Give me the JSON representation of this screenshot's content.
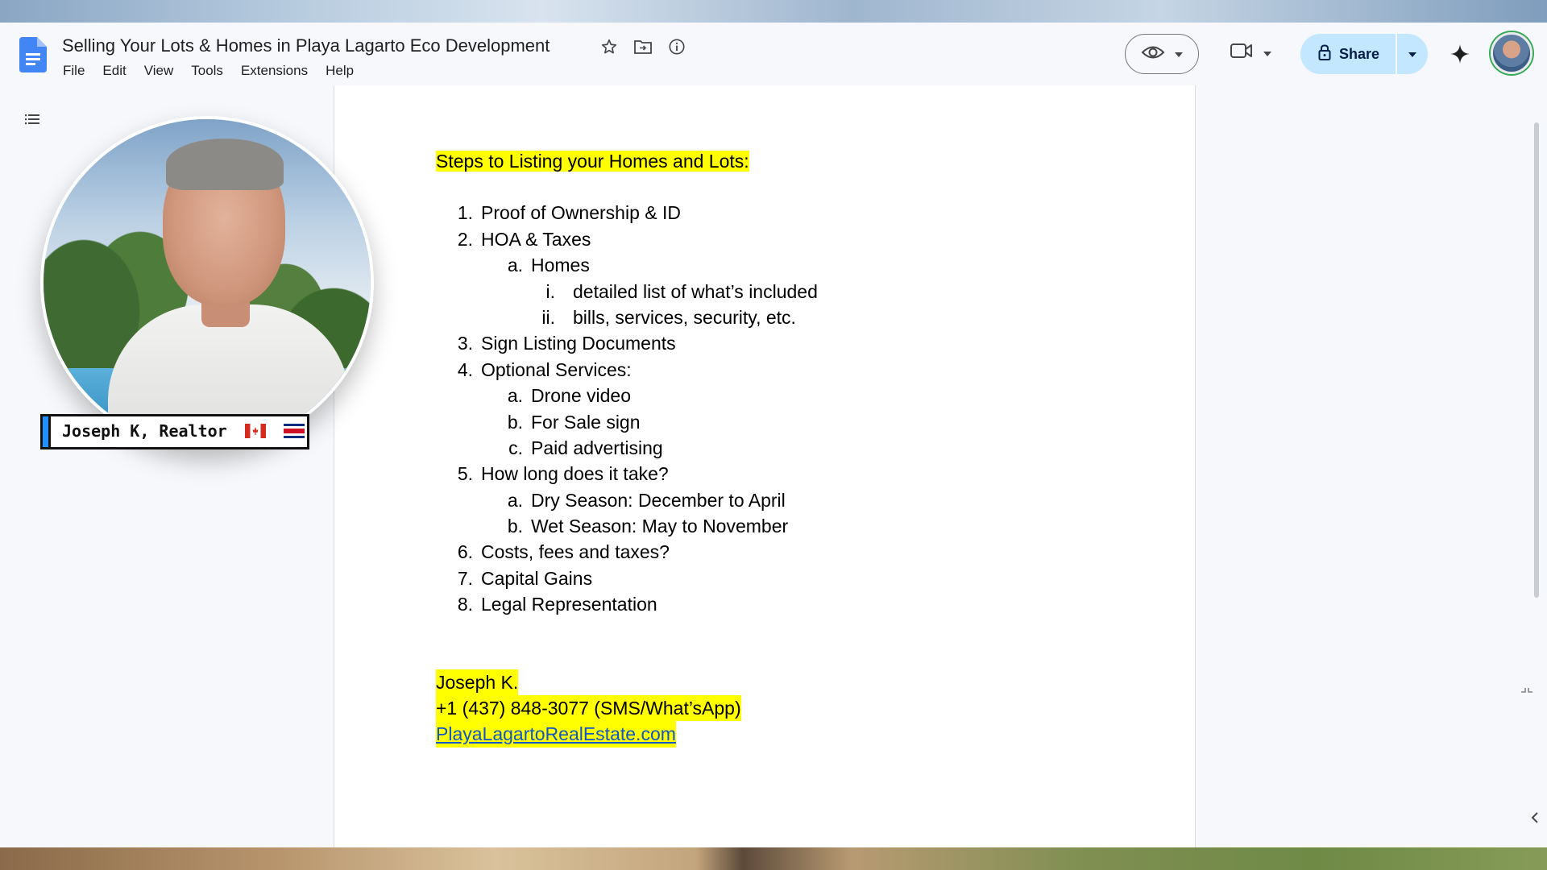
{
  "document": {
    "title": "Selling Your Lots & Homes  in Playa Lagarto Eco Development",
    "heading": "Steps to Listing your Homes and Lots:",
    "items": [
      {
        "level": 1,
        "marker": "1.",
        "text": "Proof of Ownership & ID"
      },
      {
        "level": 1,
        "marker": "2.",
        "text": "HOA & Taxes"
      },
      {
        "level": 2,
        "marker": "a.",
        "text": "Homes"
      },
      {
        "level": 3,
        "marker": "i.",
        "text": "detailed list of what’s included"
      },
      {
        "level": 3,
        "marker": "ii.",
        "text": "bills, services, security, etc."
      },
      {
        "level": 1,
        "marker": "3.",
        "text": "Sign Listing Documents"
      },
      {
        "level": 1,
        "marker": "4.",
        "text": "Optional Services:"
      },
      {
        "level": 2,
        "marker": "a.",
        "text": "Drone video"
      },
      {
        "level": 2,
        "marker": "b.",
        "text": "For Sale sign"
      },
      {
        "level": 2,
        "marker": "c.",
        "text": "Paid advertising"
      },
      {
        "level": 1,
        "marker": "5.",
        "text": "How long does it take?"
      },
      {
        "level": 2,
        "marker": "a.",
        "text": "Dry Season: December to April"
      },
      {
        "level": 2,
        "marker": "b.",
        "text": "Wet Season: May to November"
      },
      {
        "level": 1,
        "marker": "6.",
        "text": "Costs, fees and taxes?"
      },
      {
        "level": 1,
        "marker": "7.",
        "text": "Capital Gains"
      },
      {
        "level": 1,
        "marker": "8.",
        "text": "Legal Representation"
      }
    ],
    "contact": {
      "name": "Joseph K.",
      "phone": "+1 (437) 848-3077 (SMS/What’sApp)",
      "website": "PlayaLagartoRealEstate.com"
    }
  },
  "menubar": [
    "File",
    "Edit",
    "View",
    "Tools",
    "Extensions",
    "Help"
  ],
  "toolbar": {
    "share_label": "Share",
    "icons": [
      "star-icon",
      "move-folder-icon",
      "info-icon",
      "eye-icon",
      "meet-video-icon",
      "lock-icon",
      "gemini-sparkle-icon"
    ]
  },
  "overlay": {
    "nameplate": "Joseph K, Realtor",
    "flags": [
      "canada-flag",
      "costa-rica-flag"
    ]
  },
  "colors": {
    "highlight": "#ffff00",
    "link": "#1155cc",
    "share_bg": "#c2e7ff",
    "docs_blue": "#4285f4",
    "nameplate_accent": "#1e90ff"
  }
}
